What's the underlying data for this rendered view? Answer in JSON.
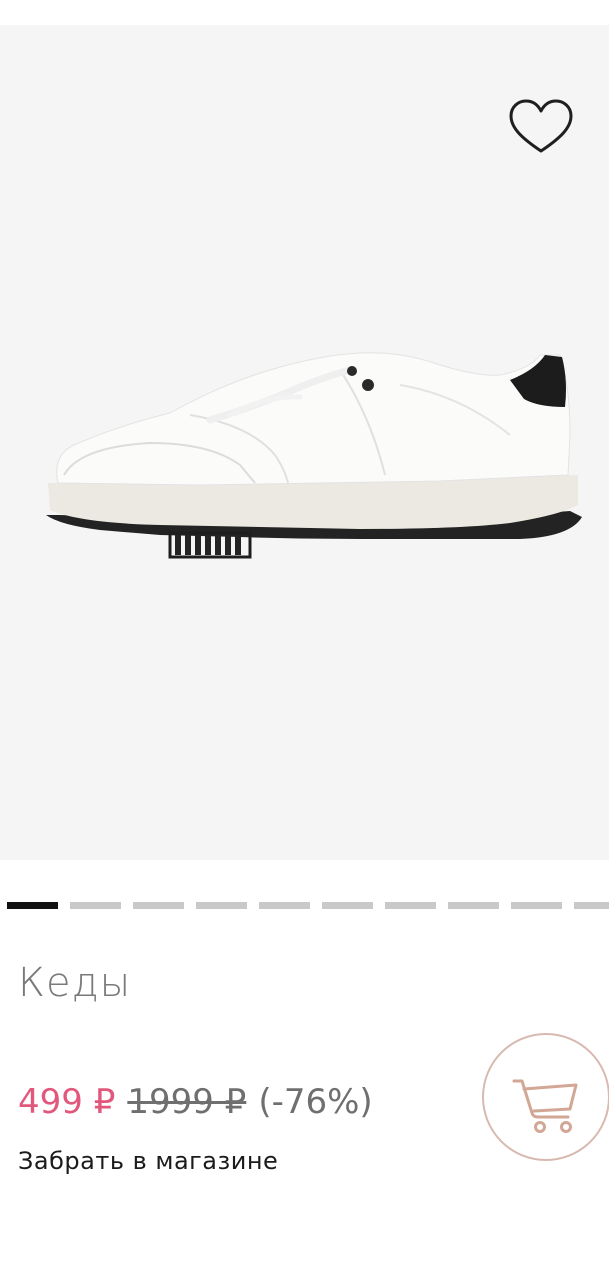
{
  "product": {
    "title": "Кеды",
    "price_current": "499 ₽",
    "price_old": "1999 ₽",
    "discount": "(-76%)",
    "pickup_text": "Забрать в магазине"
  },
  "gallery": {
    "image_count": 10,
    "active_index": 0,
    "favorite_icon": "heart-outline-icon"
  },
  "cart_button": {
    "icon": "shopping-cart-icon"
  },
  "colors": {
    "price_sale": "#e2587d",
    "cart_ring": "#d8b9b0",
    "active_dot": "#111111",
    "inactive_dot": "#c9c9c9",
    "gallery_bg": "#f5f5f5"
  }
}
